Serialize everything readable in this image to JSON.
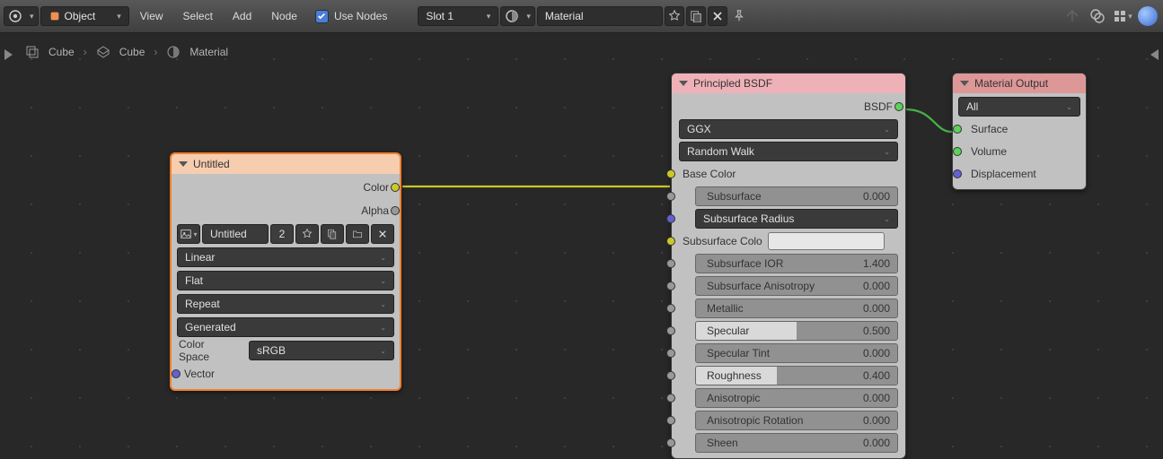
{
  "header": {
    "mode": "Object",
    "menus": [
      "View",
      "Select",
      "Add",
      "Node"
    ],
    "use_nodes_label": "Use Nodes",
    "slot": "Slot 1",
    "material_name": "Material"
  },
  "breadcrumb": {
    "items": [
      "Cube",
      "Cube",
      "Material"
    ]
  },
  "nodes": {
    "image_tex": {
      "title": "Untitled",
      "outputs": [
        "Color",
        "Alpha"
      ],
      "image_name": "Untitled",
      "users": "2",
      "interpolation": "Linear",
      "projection": "Flat",
      "extension": "Repeat",
      "mapping": "Generated",
      "colorspace_label": "Color Space",
      "colorspace": "sRGB",
      "inputs": [
        "Vector"
      ]
    },
    "principled": {
      "title": "Principled BSDF",
      "output": "BSDF",
      "distribution": "GGX",
      "sss_method": "Random Walk",
      "params": [
        {
          "label": "Base Color",
          "type": "label"
        },
        {
          "label": "Subsurface",
          "value": "0.000",
          "fill": 0
        },
        {
          "label": "Subsurface Radius",
          "type": "dropdown"
        },
        {
          "label": "Subsurface Colo",
          "type": "swatch"
        },
        {
          "label": "Subsurface IOR",
          "value": "1.400",
          "fill": 0,
          "indent": true
        },
        {
          "label": "Subsurface Anisotropy",
          "value": "0.000",
          "fill": 0,
          "indent": true
        },
        {
          "label": "Metallic",
          "value": "0.000",
          "fill": 0
        },
        {
          "label": "Specular",
          "value": "0.500",
          "fill": 50
        },
        {
          "label": "Specular Tint",
          "value": "0.000",
          "fill": 0
        },
        {
          "label": "Roughness",
          "value": "0.400",
          "fill": 40
        },
        {
          "label": "Anisotropic",
          "value": "0.000",
          "fill": 0
        },
        {
          "label": "Anisotropic Rotation",
          "value": "0.000",
          "fill": 0
        },
        {
          "label": "Sheen",
          "value": "0.000",
          "fill": 0
        }
      ]
    },
    "output": {
      "title": "Material Output",
      "target": "All",
      "inputs": [
        "Surface",
        "Volume",
        "Displacement"
      ]
    }
  }
}
